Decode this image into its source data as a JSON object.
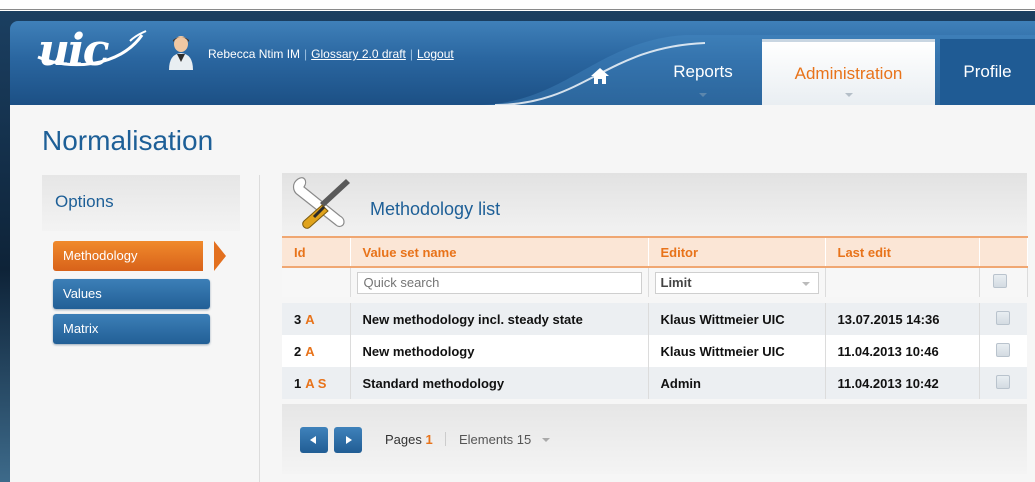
{
  "header": {
    "logo_text": "uic",
    "user_name": "Rebecca Ntim IM",
    "glossary_link": "Glossary 2.0 draft",
    "logout_link": "Logout",
    "tabs": [
      {
        "label": "Reports",
        "active": false
      },
      {
        "label": "Administration",
        "active": true
      },
      {
        "label": "Profile",
        "active": false
      }
    ],
    "icons": {
      "home": "home-icon",
      "avatar": "user-avatar-icon"
    }
  },
  "page": {
    "title": "Normalisation"
  },
  "options": {
    "title": "Options",
    "items": [
      {
        "label": "Methodology",
        "active": true
      },
      {
        "label": "Values",
        "active": false
      },
      {
        "label": "Matrix",
        "active": false
      }
    ]
  },
  "methodology": {
    "title": "Methodology list",
    "icon": "tools-icon",
    "columns": [
      "Id",
      "Value set name",
      "Editor",
      "Last edit",
      ""
    ],
    "filter": {
      "search_placeholder": "Quick search",
      "limit_placeholder": "Limit"
    },
    "rows": [
      {
        "id": "3",
        "flags": "A",
        "name": "New methodology incl. steady state",
        "editor": "Klaus Wittmeier UIC",
        "last_edit": "13.07.2015 14:36"
      },
      {
        "id": "2",
        "flags": "A",
        "name": "New methodology",
        "editor": "Klaus Wittmeier UIC",
        "last_edit": "11.04.2013 10:46"
      },
      {
        "id": "1",
        "flags": "A S",
        "name": "Standard methodology",
        "editor": "Admin",
        "last_edit": "11.04.2013 10:42"
      }
    ],
    "pager": {
      "pages_label": "Pages",
      "current_page": "1",
      "elements_label": "Elements 15"
    }
  },
  "colors": {
    "accent_orange": "#e8731a",
    "brand_blue": "#1d5f97",
    "header_blue": "#2a66a0"
  }
}
